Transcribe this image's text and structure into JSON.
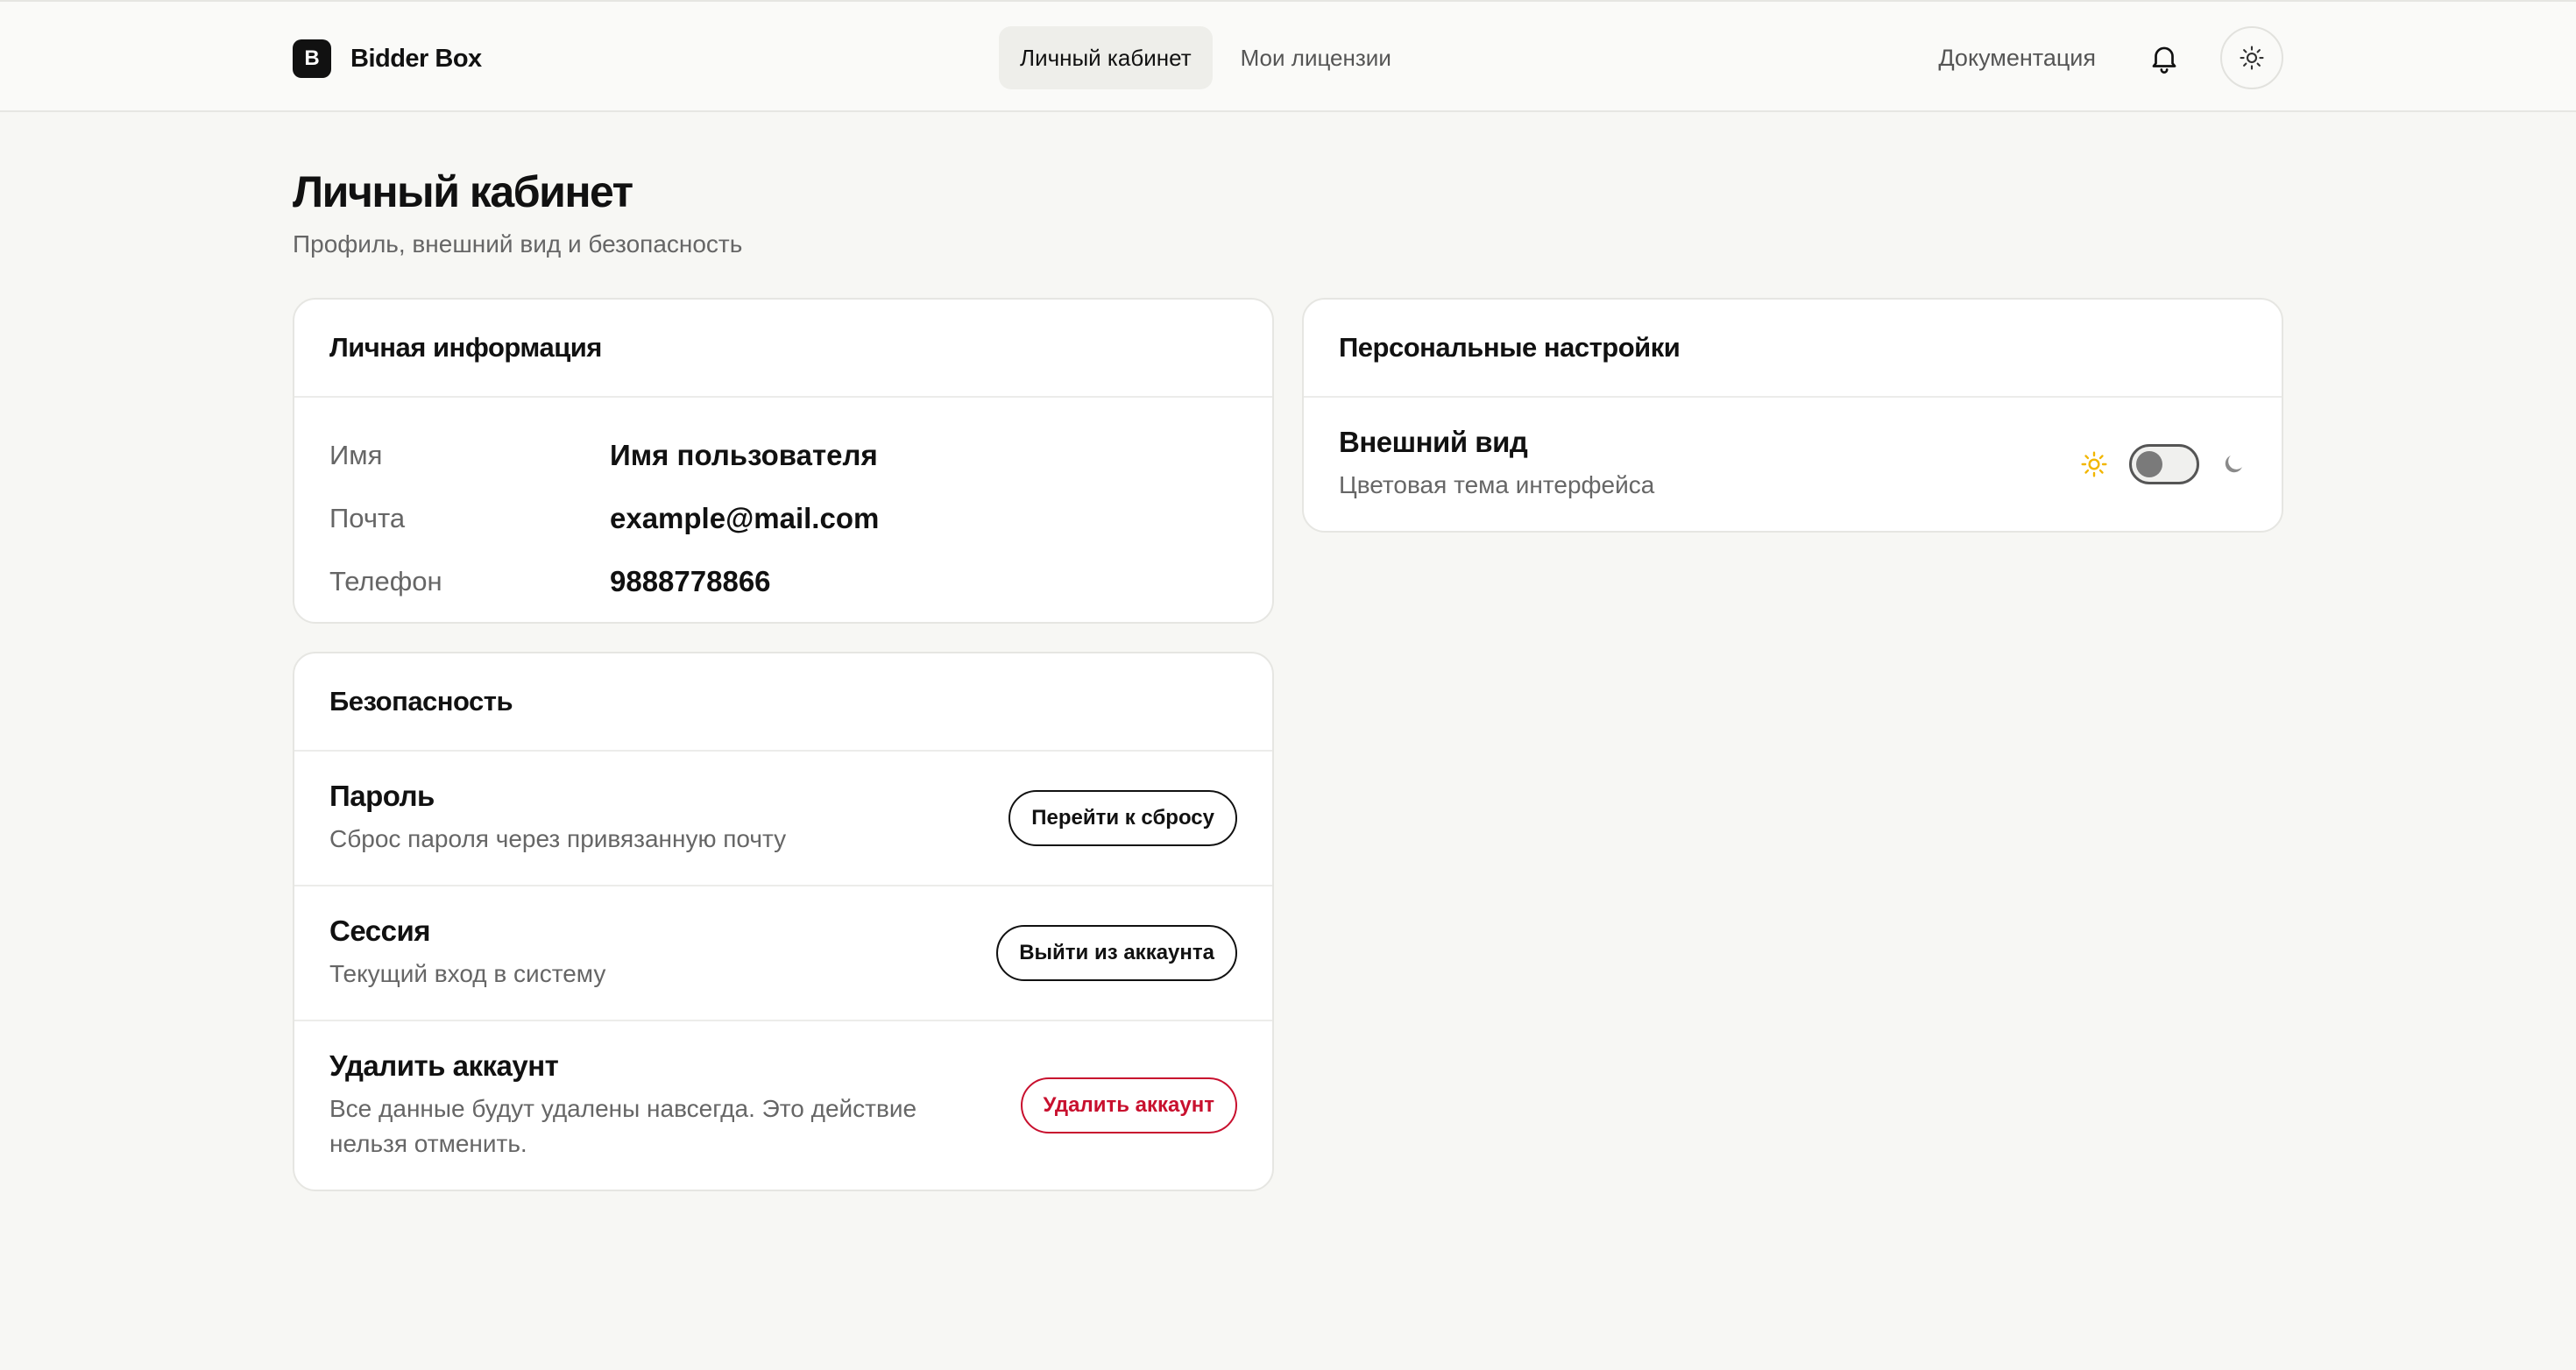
{
  "header": {
    "brand_letter": "B",
    "brand_name": "Bidder Box",
    "tabs": [
      {
        "label": "Личный кабинет",
        "active": true
      },
      {
        "label": "Мои лицензии",
        "active": false
      }
    ],
    "docs_label": "Документация",
    "icons": {
      "notifications": "bell-icon",
      "theme": "sun-icon"
    }
  },
  "page": {
    "title": "Личный кабинет",
    "subtitle": "Профиль, внешний вид и безопасность"
  },
  "personal_info": {
    "title": "Личная информация",
    "rows": [
      {
        "label": "Имя",
        "value": "Имя пользователя"
      },
      {
        "label": "Почта",
        "value": "example@mail.com"
      },
      {
        "label": "Телефон",
        "value": "9888778866"
      }
    ]
  },
  "security": {
    "title": "Безопасность",
    "password": {
      "title": "Пароль",
      "desc": "Сброс пароля через привязанную почту",
      "button": "Перейти к сбросу"
    },
    "session": {
      "title": "Сессия",
      "desc": "Текущий вход в систему",
      "button": "Выйти из аккаунта"
    },
    "delete": {
      "title": "Удалить аккаунт",
      "desc": "Все данные будут удалены навсегда. Это действие нельзя отменить.",
      "button": "Удалить аккаунт"
    }
  },
  "preferences": {
    "title": "Персональные настройки",
    "appearance": {
      "title": "Внешний вид",
      "desc": "Цветовая тема интерфейса",
      "dark_mode": false
    }
  },
  "colors": {
    "accent": "#111111",
    "danger": "#c8102e",
    "sun": "#f2b600",
    "background": "#f7f7f4"
  }
}
